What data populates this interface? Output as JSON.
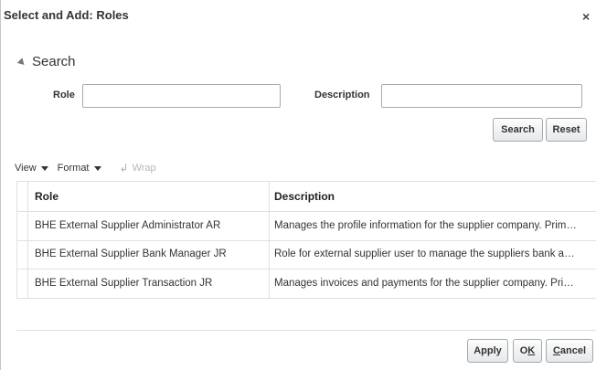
{
  "dialog": {
    "title": "Select and Add: Roles",
    "close_glyph": "×"
  },
  "search": {
    "header": "Search",
    "role_label": "Role",
    "role_value": "",
    "description_label": "Description",
    "description_value": "",
    "search_button": "Search",
    "reset_button": "Reset"
  },
  "toolbar": {
    "view_label": "View",
    "format_label": "Format",
    "wrap_label": "Wrap"
  },
  "table": {
    "columns": [
      "Role",
      "Description"
    ],
    "rows": [
      {
        "role": "BHE External Supplier Administrator AR",
        "description": "Manages the profile information for the supplier company. Prim…"
      },
      {
        "role": "BHE External Supplier Bank Manager JR",
        "description": "Role for external supplier user to manage the suppliers bank a…"
      },
      {
        "role": "BHE External Supplier Transaction JR",
        "description": "Manages invoices and payments for the supplier company. Pri…"
      }
    ]
  },
  "footer": {
    "apply_button": "Apply",
    "ok_button_prefix": "O",
    "ok_button_mnemonic": "K",
    "cancel_button_mnemonic": "C",
    "cancel_button_rest": "ancel"
  }
}
